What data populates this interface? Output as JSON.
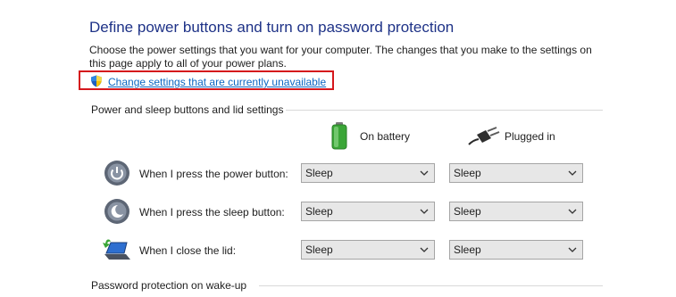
{
  "page": {
    "title": "Define power buttons and turn on password protection",
    "description": "Choose the power settings that you want for your computer. The changes that you make to the settings on this page apply to all of your power plans.",
    "change_link": "Change settings that are currently unavailable"
  },
  "sections": {
    "buttons": "Power and sleep buttons and lid settings",
    "password": "Password protection on wake-up"
  },
  "columns": {
    "battery": "On battery",
    "plugged": "Plugged in"
  },
  "rows": [
    {
      "label": "When I press the power button:",
      "battery": "Sleep",
      "plugged": "Sleep"
    },
    {
      "label": "When I press the sleep button:",
      "battery": "Sleep",
      "plugged": "Sleep"
    },
    {
      "label": "When I close the lid:",
      "battery": "Sleep",
      "plugged": "Sleep"
    }
  ],
  "colors": {
    "title": "#1e3287",
    "link": "#0b66c2",
    "highlight": "#d5171c",
    "battery": "#3aa637"
  },
  "icons": {
    "link": "uac-shield-icon",
    "battery": "battery-icon",
    "plugged": "power-plug-icon",
    "row0": "power-button-icon",
    "row1": "sleep-button-icon",
    "row2": "laptop-lid-icon"
  }
}
